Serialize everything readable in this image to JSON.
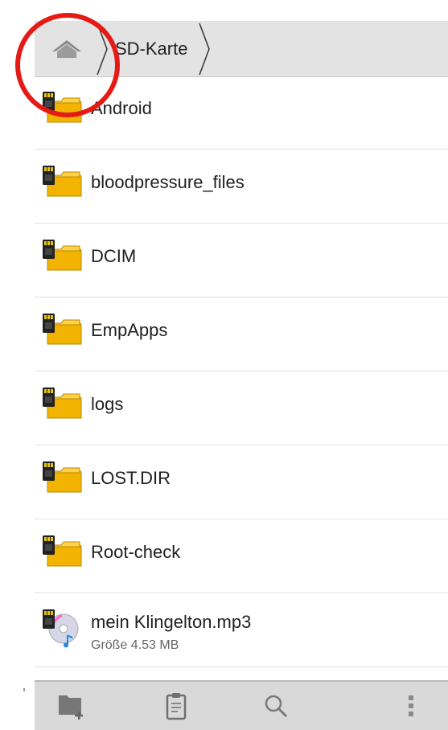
{
  "breadcrumb": {
    "home_icon": "home-icon",
    "path": [
      "SD-Karte"
    ]
  },
  "entries": [
    {
      "name": "Android",
      "icon": "sdcard-folder-icon",
      "kind": "folder"
    },
    {
      "name": "bloodpressure_files",
      "icon": "sdcard-folder-icon",
      "kind": "folder"
    },
    {
      "name": "DCIM",
      "icon": "sdcard-folder-icon",
      "kind": "folder"
    },
    {
      "name": "EmpApps",
      "icon": "sdcard-folder-icon",
      "kind": "folder"
    },
    {
      "name": "logs",
      "icon": "sdcard-folder-icon",
      "kind": "folder"
    },
    {
      "name": "LOST.DIR",
      "icon": "sdcard-folder-icon",
      "kind": "folder"
    },
    {
      "name": "Root-check",
      "icon": "sdcard-folder-icon",
      "kind": "folder"
    },
    {
      "name": "mein Klingelton.mp3",
      "icon": "sdcard-audio-file-icon",
      "kind": "file",
      "size": "Größe 4.53 MB"
    }
  ],
  "toolbar": {
    "items": [
      "new-folder-icon",
      "clipboard-icon",
      "search-icon",
      "overflow-menu-icon"
    ]
  },
  "annotation": {
    "color": "#e41a17",
    "shape": "circle"
  },
  "colors": {
    "folder": "#f5b800",
    "bar": "#e3e3e3",
    "bottom_bar": "#d9d9d9"
  }
}
